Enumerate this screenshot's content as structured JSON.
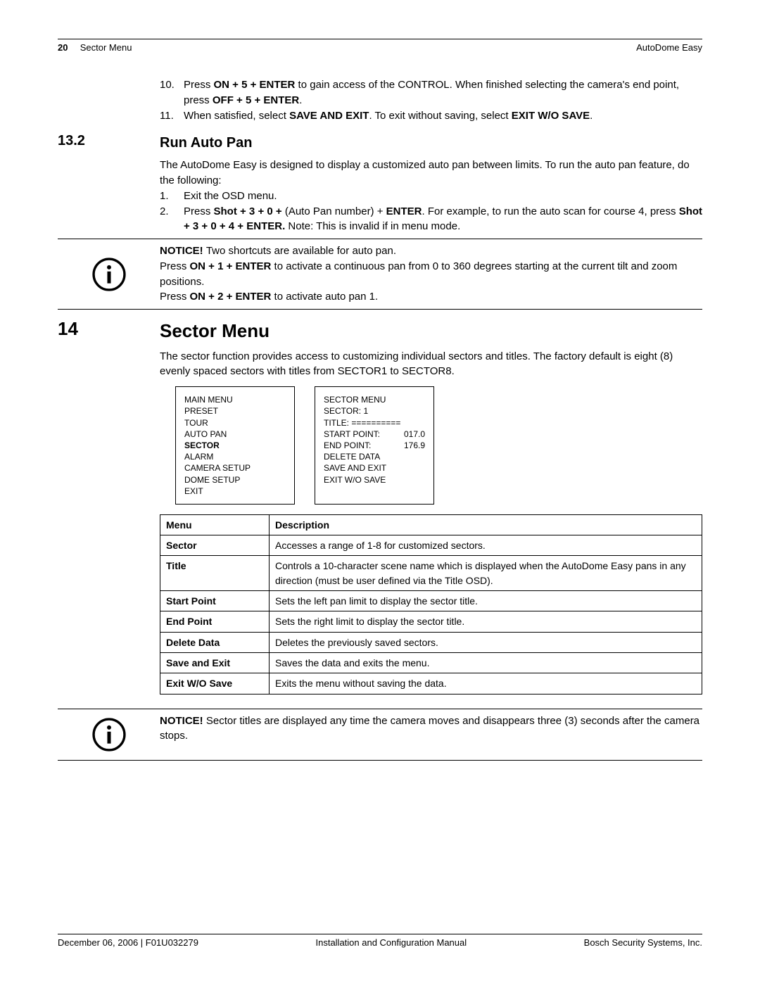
{
  "header": {
    "page_num": "20",
    "section_name": "Sector Menu",
    "product": "AutoDome Easy"
  },
  "step10": {
    "n": "10.",
    "p1": "Press ",
    "b1": "ON + 5 + ENTER",
    "p2": " to gain access of the CONTROL. When finished selecting the camera's end point, press ",
    "b2": "OFF + 5 + ENTER",
    "p3": "."
  },
  "step11": {
    "n": "11.",
    "p1": "When satisfied, select ",
    "b1": "SAVE AND EXIT",
    "p2": ". To exit without saving, select ",
    "b2": "EXIT W/O SAVE",
    "p3": "."
  },
  "sec_13_2": {
    "num": "13.2",
    "title": "Run Auto Pan"
  },
  "autopan_intro": "The AutoDome Easy is designed to display a customized auto pan between limits. To run the auto pan feature, do the following:",
  "ap1": {
    "n": "1.",
    "t": "Exit the OSD menu."
  },
  "ap2": {
    "n": "2.",
    "p1": "Press ",
    "b1": "Shot + 3 + 0 +",
    "p2": " (Auto Pan number) + ",
    "b2": "ENTER",
    "p3": ". For example, to run the auto scan for course 4, press ",
    "b3": "Shot + 3 + 0 + 4 + ENTER.",
    "p4": " Note: This is invalid if in menu mode."
  },
  "notice1": {
    "b1": "NOTICE! ",
    "l1": "Two shortcuts are available for auto pan.",
    "l2a": "Press ",
    "l2b": "ON + 1 + ENTER",
    "l2c": " to activate a continuous pan from 0 to 360 degrees starting at the current tilt and zoom positions.",
    "l3a": "Press ",
    "l3b": "ON + 2 + ENTER",
    "l3c": " to activate auto pan 1."
  },
  "sec_14": {
    "num": "14",
    "title": "Sector Menu"
  },
  "sector_intro": "The sector function provides access to customizing individual sectors and titles. The factory default is eight (8) evenly spaced sectors with titles from SECTOR1 to SECTOR8.",
  "main_menu": {
    "title": "MAIN MENU",
    "items": [
      "PRESET",
      "TOUR",
      "AUTO PAN",
      "SECTOR",
      "ALARM",
      "CAMERA SETUP",
      "DOME SETUP",
      "EXIT"
    ],
    "bold_index": 3
  },
  "sector_menu": {
    "title": "SECTOR MENU",
    "sector_label": "SECTOR:",
    "sector_val": "1",
    "title_label": "TITLE:",
    "title_val": "==========",
    "sp_label": "START POINT:",
    "sp_val": "017.0",
    "ep_label": "END POINT:",
    "ep_val": "176.9",
    "tail": [
      "DELETE DATA",
      "SAVE AND EXIT",
      "EXIT W/O SAVE"
    ]
  },
  "table": {
    "h1": "Menu",
    "h2": "Description",
    "rows": [
      {
        "m": "Sector",
        "d": "Accesses a range of 1-8 for customized sectors."
      },
      {
        "m": "Title",
        "d": "Controls a 10-character scene name which is displayed when the AutoDome Easy pans in any direction (must be user defined via the Title OSD)."
      },
      {
        "m": "Start Point",
        "d": "Sets the left pan limit to display the sector title."
      },
      {
        "m": "End Point",
        "d": "Sets the right limit to display the sector title."
      },
      {
        "m": "Delete Data",
        "d": "Deletes the previously saved sectors."
      },
      {
        "m": "Save and Exit",
        "d": "Saves the data and exits the menu."
      },
      {
        "m": "Exit W/O Save",
        "d": "Exits the menu without saving the data."
      }
    ]
  },
  "notice2": {
    "b1": "NOTICE! ",
    "t": "Sector titles are displayed any time the camera moves and disappears three (3) seconds after the camera stops."
  },
  "footer": {
    "left": "December 06, 2006 | F01U032279",
    "center": "Installation and Configuration Manual",
    "right": "Bosch Security Systems, Inc."
  }
}
